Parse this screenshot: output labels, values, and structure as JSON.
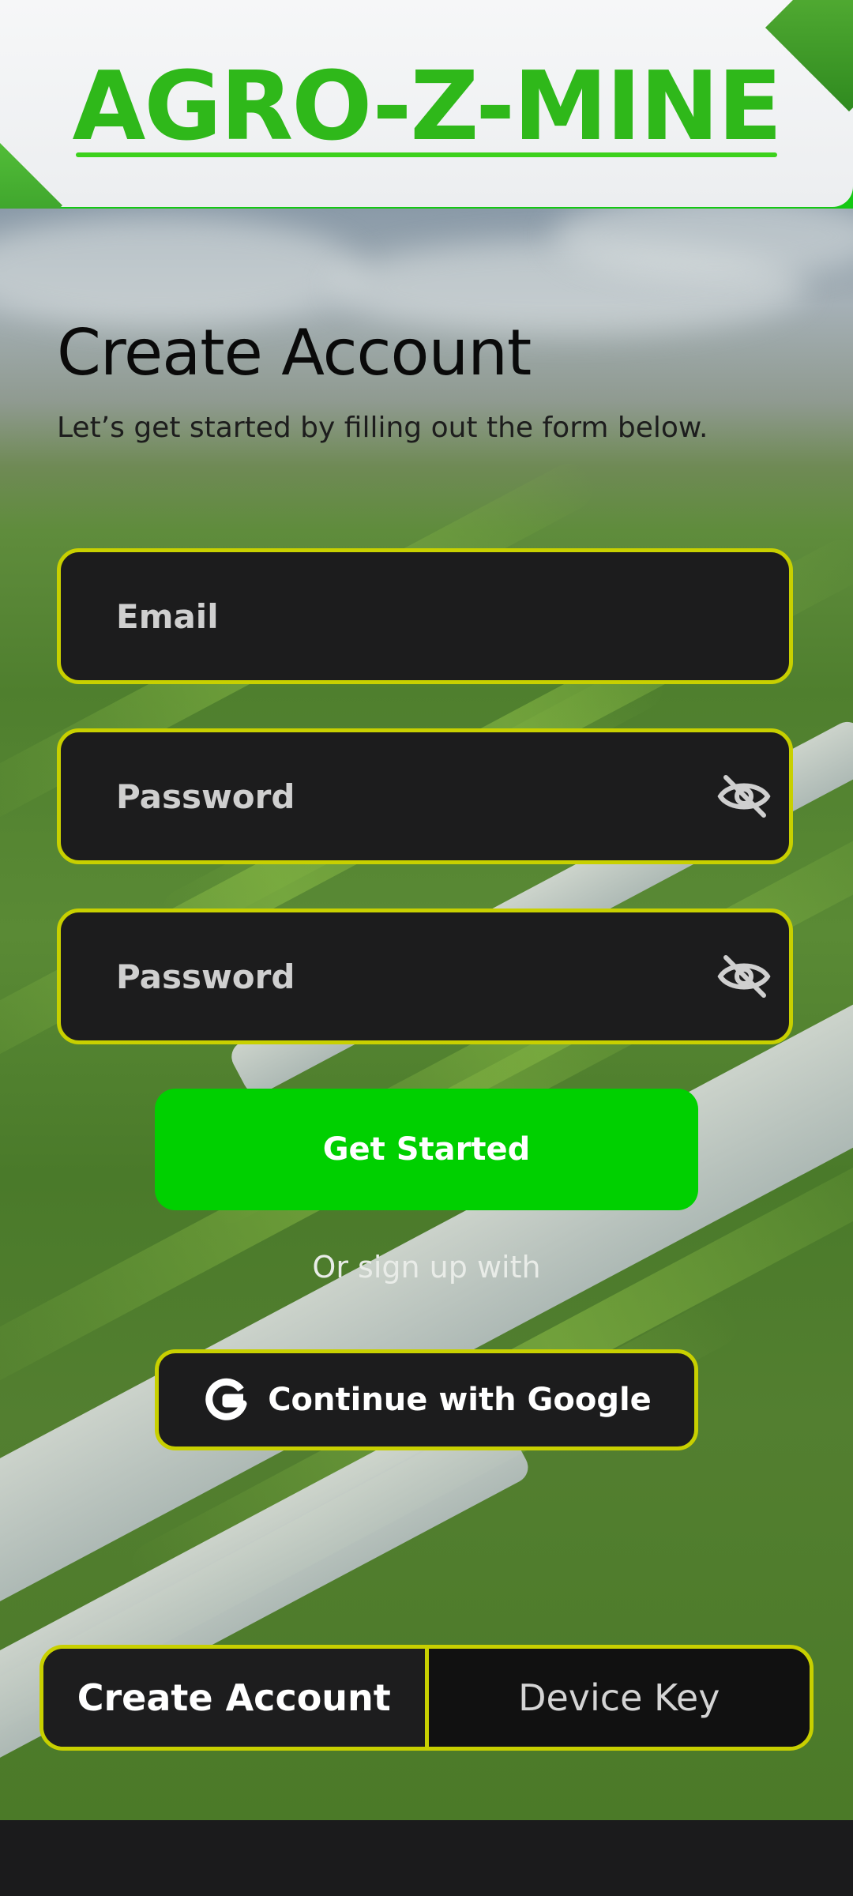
{
  "header": {
    "brand": "AGRO-Z-MINE"
  },
  "form": {
    "title": "Create Account",
    "subtitle": "Let’s get started by filling out the form below.",
    "email_placeholder": "Email",
    "password_placeholder": "Password",
    "confirm_password_placeholder": "Password",
    "submit_label": "Get Started",
    "alt_signup_text": "Or sign up with",
    "google_label": "Continue with Google"
  },
  "bottom_toggle": {
    "active": "Create Account",
    "inactive": "Device Key"
  },
  "colors": {
    "brand_green": "#2fb81a",
    "accent_border": "#c8d000",
    "primary_button": "#00d000",
    "field_bg": "#1c1c1d"
  },
  "icons": {
    "password_visibility": "eye-slash-icon",
    "google": "google-g-icon"
  }
}
